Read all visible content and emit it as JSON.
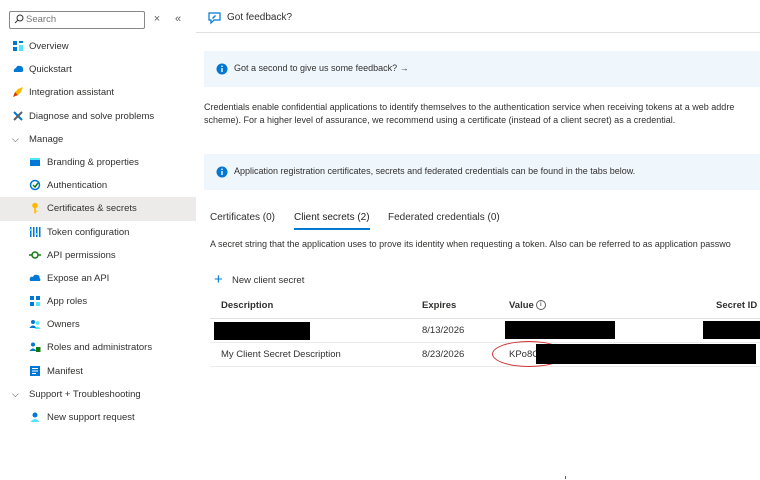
{
  "sidebar": {
    "search_placeholder": "Search",
    "close_label": "×",
    "collapse_label": "«",
    "items": [
      {
        "label": "Overview",
        "icon": "overview-icon",
        "level": 0
      },
      {
        "label": "Quickstart",
        "icon": "quickstart-icon",
        "level": 0
      },
      {
        "label": "Integration assistant",
        "icon": "rocket-icon",
        "level": 0
      },
      {
        "label": "Diagnose and solve problems",
        "icon": "wrench-icon",
        "level": 0
      },
      {
        "label": "Manage",
        "icon": "chevron-down-icon",
        "level": 0,
        "group": true
      },
      {
        "label": "Branding & properties",
        "icon": "branding-icon",
        "level": 1
      },
      {
        "label": "Authentication",
        "icon": "authentication-icon",
        "level": 1
      },
      {
        "label": "Certificates & secrets",
        "icon": "key-icon",
        "level": 1,
        "selected": true
      },
      {
        "label": "Token configuration",
        "icon": "token-config-icon",
        "level": 1
      },
      {
        "label": "API permissions",
        "icon": "api-permissions-icon",
        "level": 1
      },
      {
        "label": "Expose an API",
        "icon": "cloud-icon",
        "level": 1
      },
      {
        "label": "App roles",
        "icon": "app-roles-icon",
        "level": 1
      },
      {
        "label": "Owners",
        "icon": "owners-icon",
        "level": 1
      },
      {
        "label": "Roles and administrators",
        "icon": "roles-admins-icon",
        "level": 1
      },
      {
        "label": "Manifest",
        "icon": "manifest-icon",
        "level": 1
      },
      {
        "label": "Support + Troubleshooting",
        "icon": "chevron-down-icon",
        "level": 0,
        "group": true
      },
      {
        "label": "New support request",
        "icon": "support-request-icon",
        "level": 1
      }
    ]
  },
  "header": {
    "feedback_label": "Got feedback?"
  },
  "banner_feedback": {
    "text": "Got a second to give us some feedback? →"
  },
  "description": {
    "line1": "Credentials enable confidential applications to identify themselves to the authentication service when receiving tokens at a web addre",
    "line2": "scheme). For a higher level of assurance, we recommend using a certificate (instead of a client secret) as a credential."
  },
  "banner_info": {
    "text": "Application registration certificates, secrets and federated credentials can be found in the tabs below."
  },
  "tabs": [
    {
      "label": "Certificates (0)",
      "active": false
    },
    {
      "label": "Client secrets (2)",
      "active": true
    },
    {
      "label": "Federated credentials (0)",
      "active": false
    }
  ],
  "hint": "A secret string that the application uses to prove its identity when requesting a token. Also can be referred to as application passwo",
  "new_secret_label": "New client secret",
  "table": {
    "headers": {
      "description": "Description",
      "expires": "Expires",
      "value": "Value",
      "secret_id": "Secret ID"
    },
    "rows": [
      {
        "description": "",
        "expires": "8/13/2026",
        "value": "",
        "secret_id": ""
      },
      {
        "description": "My Client Secret Description",
        "expires": "8/23/2026",
        "value": "KPo8C",
        "secret_id": ""
      }
    ]
  },
  "colors": {
    "accent": "#0078d4",
    "banner_bg": "#eff6fc",
    "selected_bg": "#edebe9",
    "annotation_red": "#d13438"
  }
}
